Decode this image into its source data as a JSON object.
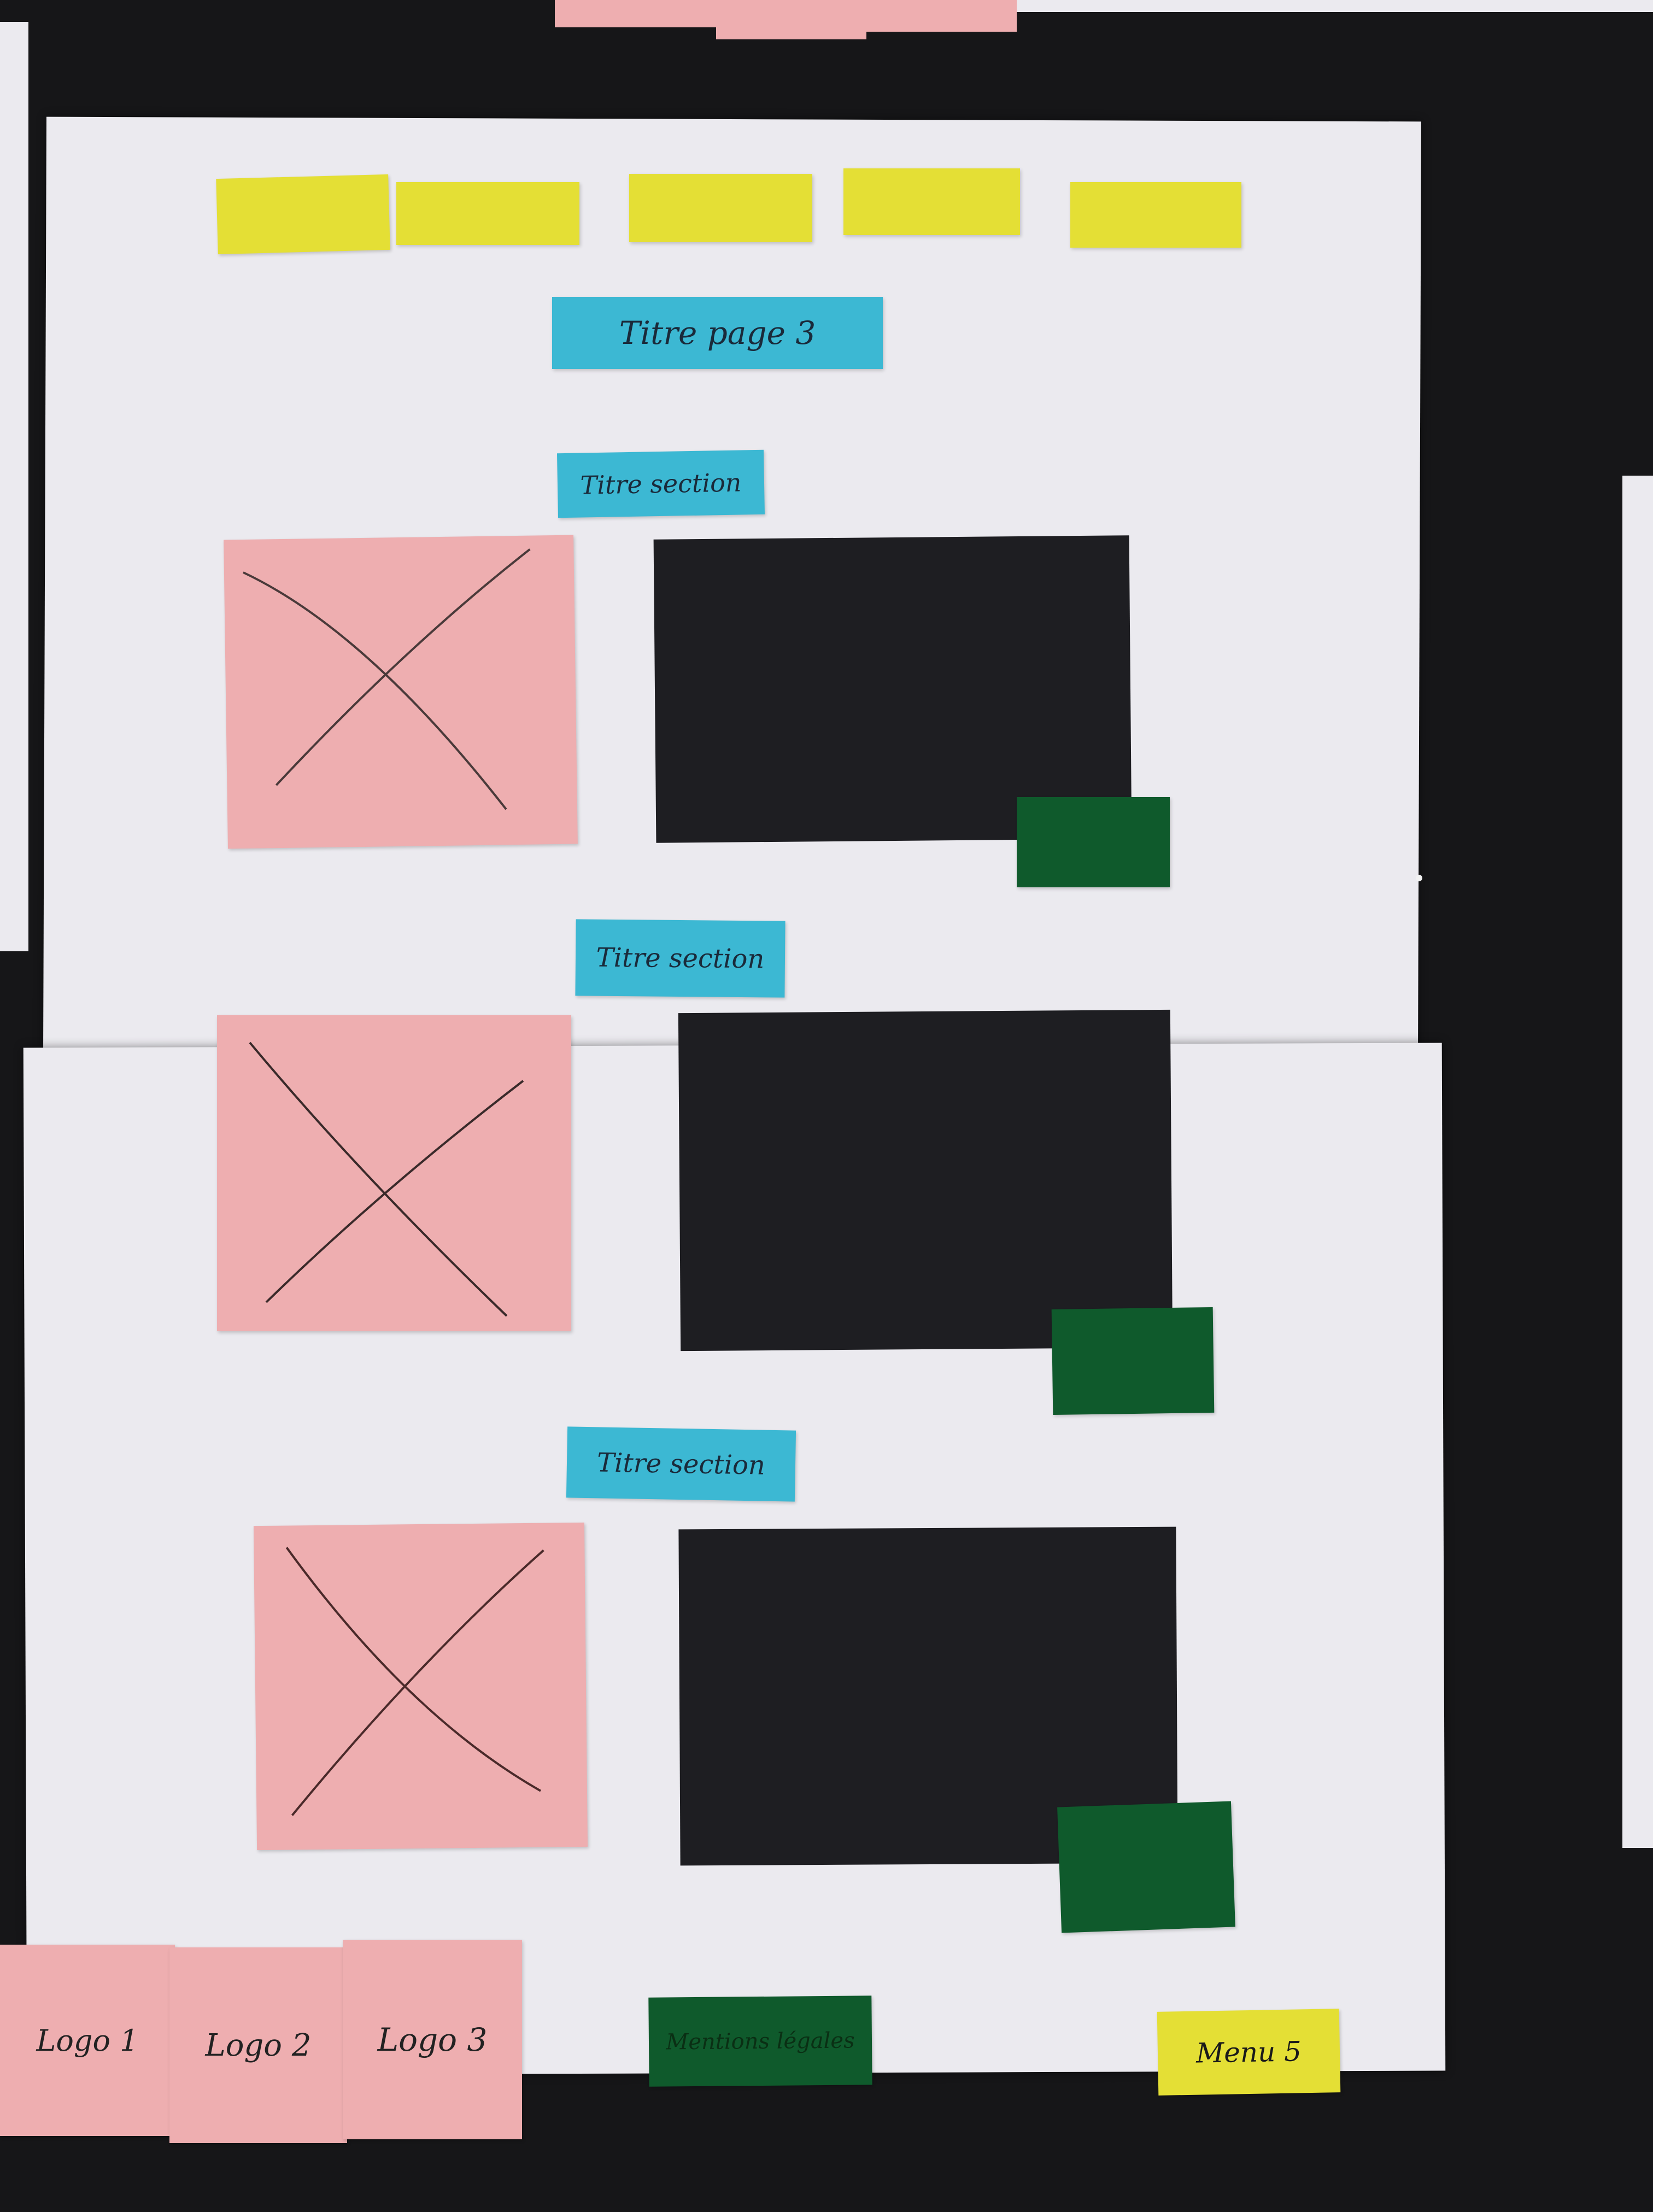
{
  "page_title": "Titre page 3",
  "sections": [
    {
      "title": "Titre section"
    },
    {
      "title": "Titre section"
    },
    {
      "title": "Titre section"
    }
  ],
  "footer": {
    "logos": [
      "Logo 1",
      "Logo 2",
      "Logo 3"
    ],
    "legal": "Mentions légales",
    "menu": "Menu 5"
  },
  "colors": {
    "menu_note": "#e4df35",
    "title_note": "#3cb8d3",
    "image_note": "#eeaeb0",
    "text_block": "#1e1e22",
    "button_note": "#0f5a2c",
    "paper": "#ebeaef",
    "table": "#161618"
  }
}
